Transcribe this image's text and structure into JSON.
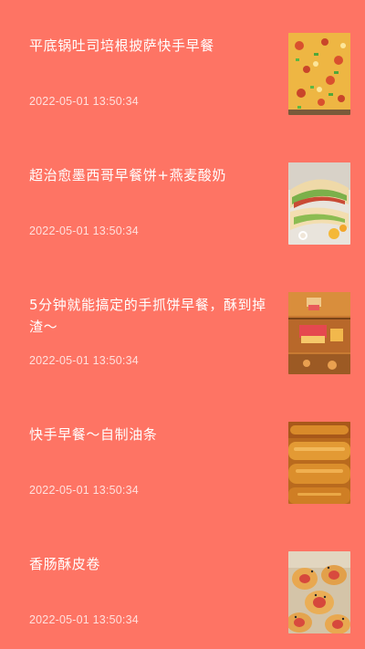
{
  "feed": {
    "items": [
      {
        "title": "平底锅吐司培根披萨快手早餐",
        "time": "2022-05-01  13:50:34",
        "thumbnail": "pizza-toast-photo"
      },
      {
        "title": "超治愈墨西哥早餐饼+燕麦酸奶",
        "time": "2022-05-01  13:50:34",
        "thumbnail": "mexican-wrap-photo"
      },
      {
        "title": "5分钟就能搞定的手抓饼早餐，酥到掉渣～",
        "time": "2022-05-01  13:50:34",
        "thumbnail": "flatbread-photo"
      },
      {
        "title": "快手早餐～自制油条",
        "time": "2022-05-01  13:50:34",
        "thumbnail": "fried-dough-photo"
      },
      {
        "title": "香肠酥皮卷",
        "time": "2022-05-01  13:50:34",
        "thumbnail": "sausage-roll-photo"
      }
    ]
  }
}
